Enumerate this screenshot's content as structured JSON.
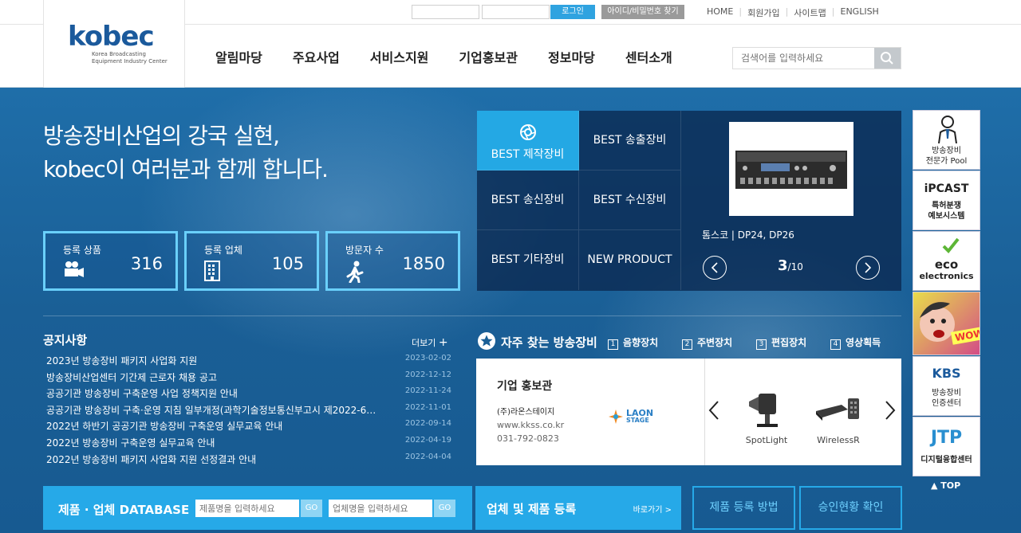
{
  "topbar": {
    "login_label": "로그인",
    "find_label": "아이디/비밀번호 찾기",
    "util_links": [
      "HOME",
      "회원가입",
      "사이트맵",
      "ENGLISH"
    ]
  },
  "logo": {
    "text": "kobec",
    "sub1": "Korea Broadcasting",
    "sub2": "Equipment Industry Center"
  },
  "gnb": [
    "알림마당",
    "주요사업",
    "서비스지원",
    "기업홍보관",
    "정보마당",
    "센터소개"
  ],
  "search": {
    "placeholder": "검색어를 입력하세요"
  },
  "hero": {
    "slogan1": "방송장비산업의 강국 실현,",
    "slogan2": "kobec이 여러분과 함께 합니다."
  },
  "stats": [
    {
      "label": "등록 상품",
      "value": "316",
      "icon": "camera-icon"
    },
    {
      "label": "등록 업체",
      "value": "105",
      "icon": "building-icon"
    },
    {
      "label": "방문자 수",
      "value": "1850",
      "icon": "walker-icon"
    }
  ],
  "best": {
    "tabs": [
      "BEST 제작장비",
      "BEST 송출장비",
      "BEST 송신장비",
      "BEST 수신장비",
      "BEST 기타장비",
      "NEW PRODUCT"
    ],
    "product_caption": "톰스코 | DP24, DP26",
    "page_current": "3",
    "page_total": "/10"
  },
  "side_banners": [
    {
      "title": "방송장비",
      "sub": "전문가 Pool"
    },
    {
      "brand": "iPCAST",
      "title": "특허분쟁",
      "sub": "예보시스템"
    },
    {
      "brand1": "eco",
      "brand2": "electronics"
    },
    {
      "bubble": "WOW"
    },
    {
      "brand": "KBS",
      "title": "방송장비",
      "sub": "인증센터"
    },
    {
      "brand": "JTP",
      "title": "디지털융합센터"
    }
  ],
  "top_link": "▲ TOP",
  "notice": {
    "title": "공지사항",
    "more": "더보기",
    "items": [
      {
        "title": "2023년 방송장비 패키지 사업화 지원",
        "date": "2023-02-02"
      },
      {
        "title": "방송장비산업센터 기간제 근로자 채용 공고",
        "date": "2022-12-12"
      },
      {
        "title": "공공기관 방송장비 구축운영 사업 정책지원 안내",
        "date": "2022-11-24"
      },
      {
        "title": "공공기관 방송장비 구축·운영 지침 일부개정(과학기술정보통신부고시 제2022-6…",
        "date": "2022-11-01"
      },
      {
        "title": "2022년 하반기 공공기관 방송장비 구축운영 실무교육 안내",
        "date": "2022-09-14"
      },
      {
        "title": "2022년 방송장비 구축운영 실무교육 안내",
        "date": "2022-04-19"
      },
      {
        "title": "2022년 방송장비 패키지 사업화 지원 선정결과 안내",
        "date": "2022-04-04"
      }
    ]
  },
  "freq": {
    "title": "자주 찾는 방송장비",
    "cats": [
      {
        "n": "1",
        "label": "음향장치"
      },
      {
        "n": "2",
        "label": "주변장치"
      },
      {
        "n": "3",
        "label": "편집장치"
      },
      {
        "n": "4",
        "label": "영상획득"
      }
    ]
  },
  "company": {
    "title": "기업 홍보관",
    "name": "(주)라온스테이지",
    "url": "www.kkss.co.kr",
    "tel": "031-792-0823",
    "logo_text1": "LAON",
    "logo_text2": "STAGE",
    "items": [
      "SpotLight",
      "WirelessR"
    ]
  },
  "database": {
    "title": "제품 · 업체 DATABASE",
    "product_placeholder": "제품명을 입력하세요",
    "company_placeholder": "업체명을 입력하세요",
    "go": "GO"
  },
  "register": {
    "title": "업체 및 제품 등록",
    "more": "바로가기 >"
  },
  "buttons": {
    "howto": "제품 등록 방법",
    "approval": "승인현황 확인"
  },
  "colors": {
    "accent": "#26a9e8",
    "stat_border": "#6ad0fb",
    "brand": "#1b5a9c"
  }
}
